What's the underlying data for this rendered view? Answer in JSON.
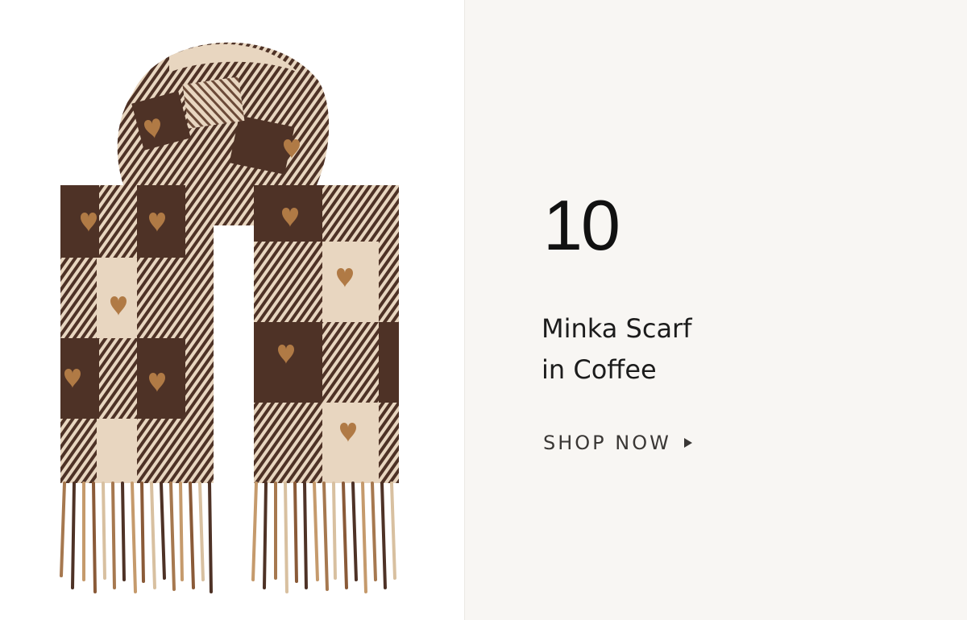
{
  "product": {
    "rank": "10",
    "title_line1": "Minka Scarf",
    "title_line2": "in Coffee",
    "cta_label": "SHOP NOW",
    "image_icon": "scarf-product-image"
  },
  "colors": {
    "panel_background": "#f8f6f3",
    "scarf_dark": "#5a3a2a",
    "scarf_light": "#e8d6c0",
    "heart": "#b07a45",
    "text": "#1c1c1c"
  }
}
